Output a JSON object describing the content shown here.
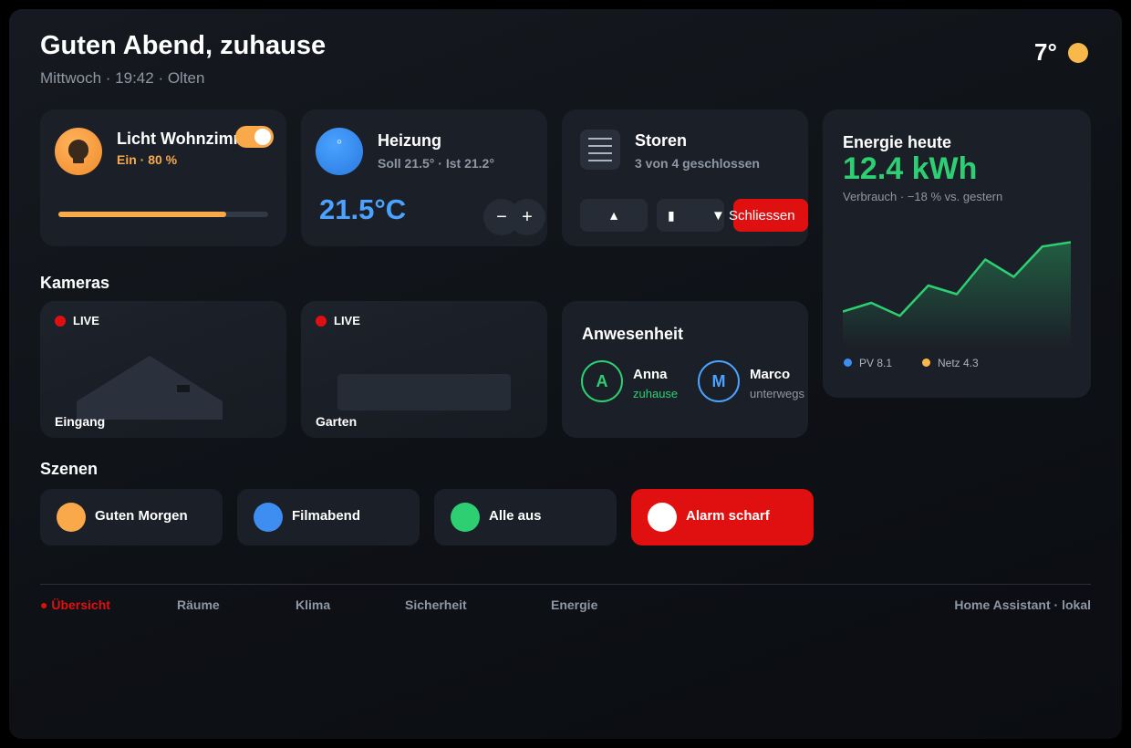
{
  "header": {
    "greeting": "Guten Abend, zuhause",
    "subtitle": "Mittwoch · 19:42 · Olten",
    "weather_temp": "7°",
    "weather_icon": "sun-icon"
  },
  "light": {
    "title": "Licht Wohnzimm",
    "status": "Ein · 80 %",
    "on": true,
    "brightness_pct": 80,
    "icon": "bulb-icon",
    "accent": "#f9a94a"
  },
  "heating": {
    "title": "Heizung",
    "status": "Soll 21.5° · Ist 21.2°",
    "current": "21.5°C",
    "minus": "−",
    "plus": "+",
    "icon_glyph": "°",
    "accent": "#4ba3ff"
  },
  "blinds": {
    "title": "Storen",
    "status": "3 von 4 geschlossen",
    "up": "▲",
    "stop": "▮",
    "close": "▼ Schliessen",
    "icon": "blinds-icon"
  },
  "energy": {
    "title": "Energie heute",
    "value": "12.4 kWh",
    "sub": "Verbrauch · −18 % vs. gestern",
    "legend": [
      {
        "label": "PV 8.1",
        "color": "#3d8ef0"
      },
      {
        "label": "Netz 4.3",
        "color": "#f9b84a"
      }
    ]
  },
  "chart_data": {
    "type": "area",
    "x": [
      0,
      1,
      2,
      3,
      4,
      5,
      6,
      7,
      8
    ],
    "values": [
      3.0,
      4.0,
      2.5,
      6.0,
      5.0,
      9.0,
      7.0,
      10.5,
      11.0
    ],
    "ylim": [
      0,
      12
    ],
    "color": "#2ecf72",
    "grid": false,
    "legend_placement": "bottom-left"
  },
  "cameras": {
    "title": "Kameras",
    "items": [
      {
        "live": "LIVE",
        "label": "Eingang"
      },
      {
        "live": "LIVE",
        "label": "Garten"
      }
    ]
  },
  "presence": {
    "title": "Anwesenheit",
    "people": [
      {
        "initial": "A",
        "name": "Anna",
        "status": "zuhause",
        "color": "#2ecf72"
      },
      {
        "initial": "M",
        "name": "Marco",
        "status": "unterwegs",
        "color": "#4ba3ff"
      }
    ]
  },
  "scenes": {
    "title": "Szenen",
    "items": [
      {
        "label": "Guten Morgen",
        "color": "#f9a94a"
      },
      {
        "label": "Filmabend",
        "color": "#3d8ef0"
      },
      {
        "label": "Alle aus",
        "color": "#2ecf72"
      },
      {
        "label": "Alarm scharf",
        "color": "#ffffff"
      }
    ]
  },
  "nav": {
    "items": [
      "● Übersicht",
      "Räume",
      "Klima",
      "Sicherheit",
      "Energie"
    ],
    "active_color": "#e01010",
    "footer": "Home Assistant · lokal"
  }
}
